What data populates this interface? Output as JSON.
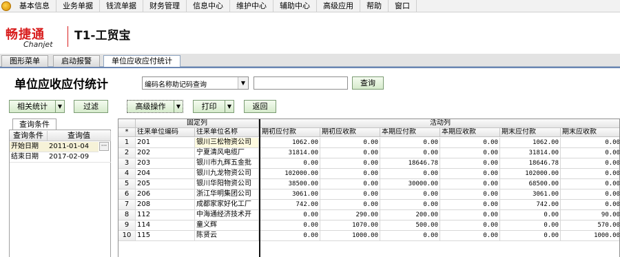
{
  "menu": [
    "基本信息",
    "业务单据",
    "钱流单据",
    "财务管理",
    "信息中心",
    "维护中心",
    "辅助中心",
    "高级应用",
    "帮助",
    "窗口"
  ],
  "brand": {
    "name_cn": "畅捷通",
    "name_en": "Chanjet",
    "product": "T1-工贸宝"
  },
  "tabs": [
    "图形菜单",
    "启动报警",
    "单位应收应付统计"
  ],
  "page_title": "单位应收应付统计",
  "search": {
    "mode": "编码名称助记码查询",
    "value": "",
    "button": "查询"
  },
  "toolbar": {
    "stats": "相关统计",
    "filter": "过滤",
    "advanced": "高级操作",
    "print": "打印",
    "back": "返回"
  },
  "query_panel": {
    "tab": "查询条件",
    "headers": [
      "查询条件",
      "查询值"
    ],
    "rows": [
      {
        "name": "开始日期",
        "value": "2011-01-04"
      },
      {
        "name": "结束日期",
        "value": "2017-02-09"
      }
    ]
  },
  "grid": {
    "group_fixed": "固定列",
    "group_active": "活动列",
    "corner": "*",
    "columns": [
      "往来单位编码",
      "往来单位名称",
      "期初应付款",
      "期初应收款",
      "本期应付款",
      "本期应收款",
      "期末应付款",
      "期末应收款"
    ],
    "rows": [
      {
        "n": "1",
        "code": "201",
        "name": "银川三松物资公司",
        "v": [
          "1062.00",
          "0.00",
          "0.00",
          "0.00",
          "1062.00",
          "0.00"
        ]
      },
      {
        "n": "2",
        "code": "202",
        "name": "宁夏清风电缆厂",
        "v": [
          "31814.00",
          "0.00",
          "0.00",
          "0.00",
          "31814.00",
          "0.00"
        ]
      },
      {
        "n": "3",
        "code": "203",
        "name": "银川市九辉五金批",
        "v": [
          "0.00",
          "0.00",
          "18646.78",
          "0.00",
          "18646.78",
          "0.00"
        ]
      },
      {
        "n": "4",
        "code": "204",
        "name": "银川九龙物资公司",
        "v": [
          "102000.00",
          "0.00",
          "0.00",
          "0.00",
          "102000.00",
          "0.00"
        ]
      },
      {
        "n": "5",
        "code": "205",
        "name": "银川华阳物资公司",
        "v": [
          "38500.00",
          "0.00",
          "30000.00",
          "0.00",
          "68500.00",
          "0.00"
        ]
      },
      {
        "n": "6",
        "code": "206",
        "name": "浙江华明集团公司",
        "v": [
          "3061.00",
          "0.00",
          "0.00",
          "0.00",
          "3061.00",
          "0.00"
        ]
      },
      {
        "n": "7",
        "code": "208",
        "name": "成都家家好化工厂",
        "v": [
          "742.00",
          "0.00",
          "0.00",
          "0.00",
          "742.00",
          "0.00"
        ]
      },
      {
        "n": "8",
        "code": "112",
        "name": "中海通经济技术开",
        "v": [
          "0.00",
          "290.00",
          "200.00",
          "0.00",
          "0.00",
          "90.00"
        ]
      },
      {
        "n": "9",
        "code": "114",
        "name": "童义辉",
        "v": [
          "0.00",
          "1070.00",
          "500.00",
          "0.00",
          "0.00",
          "570.00"
        ]
      },
      {
        "n": "10",
        "code": "115",
        "name": "陈贤云",
        "v": [
          "0.00",
          "1000.00",
          "0.00",
          "0.00",
          "0.00",
          "1000.00"
        ]
      }
    ]
  }
}
